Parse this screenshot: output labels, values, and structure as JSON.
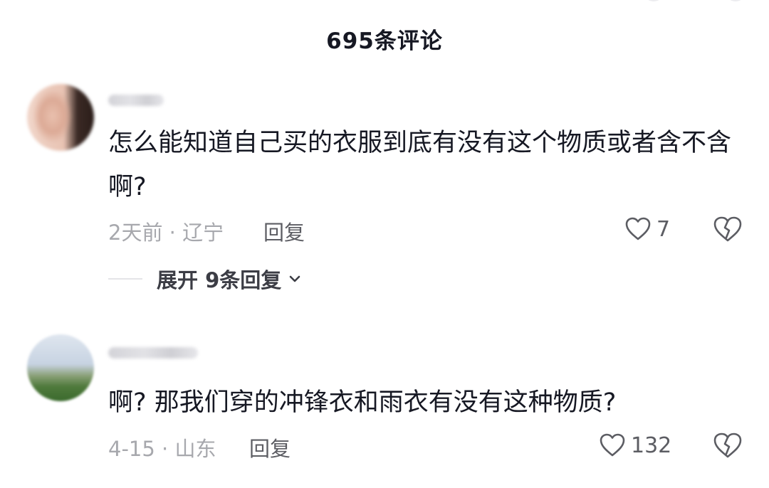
{
  "header": {
    "title": "695条评论"
  },
  "comments": [
    {
      "text": "怎么能知道自己买的衣服到底有没有这个物质或者含不含啊?",
      "time_location": "2天前 · 辽宁",
      "reply_label": "回复",
      "likes": "7",
      "expand_label": "展开 9条回复"
    },
    {
      "text": "啊? 那我们穿的冲锋衣和雨衣有没有这种物质?",
      "time_location": "4-15 · 山东",
      "reply_label": "回复",
      "likes": "132"
    }
  ],
  "icons": {
    "like": "heart-outline-icon",
    "dislike": "broken-heart-icon",
    "expand": "chevron-down-icon"
  },
  "colors": {
    "text_primary": "#161823",
    "text_secondary": "#a7a8ad",
    "action_text": "#5c5d63",
    "divider": "#e4e4e8",
    "background": "#ffffff"
  }
}
